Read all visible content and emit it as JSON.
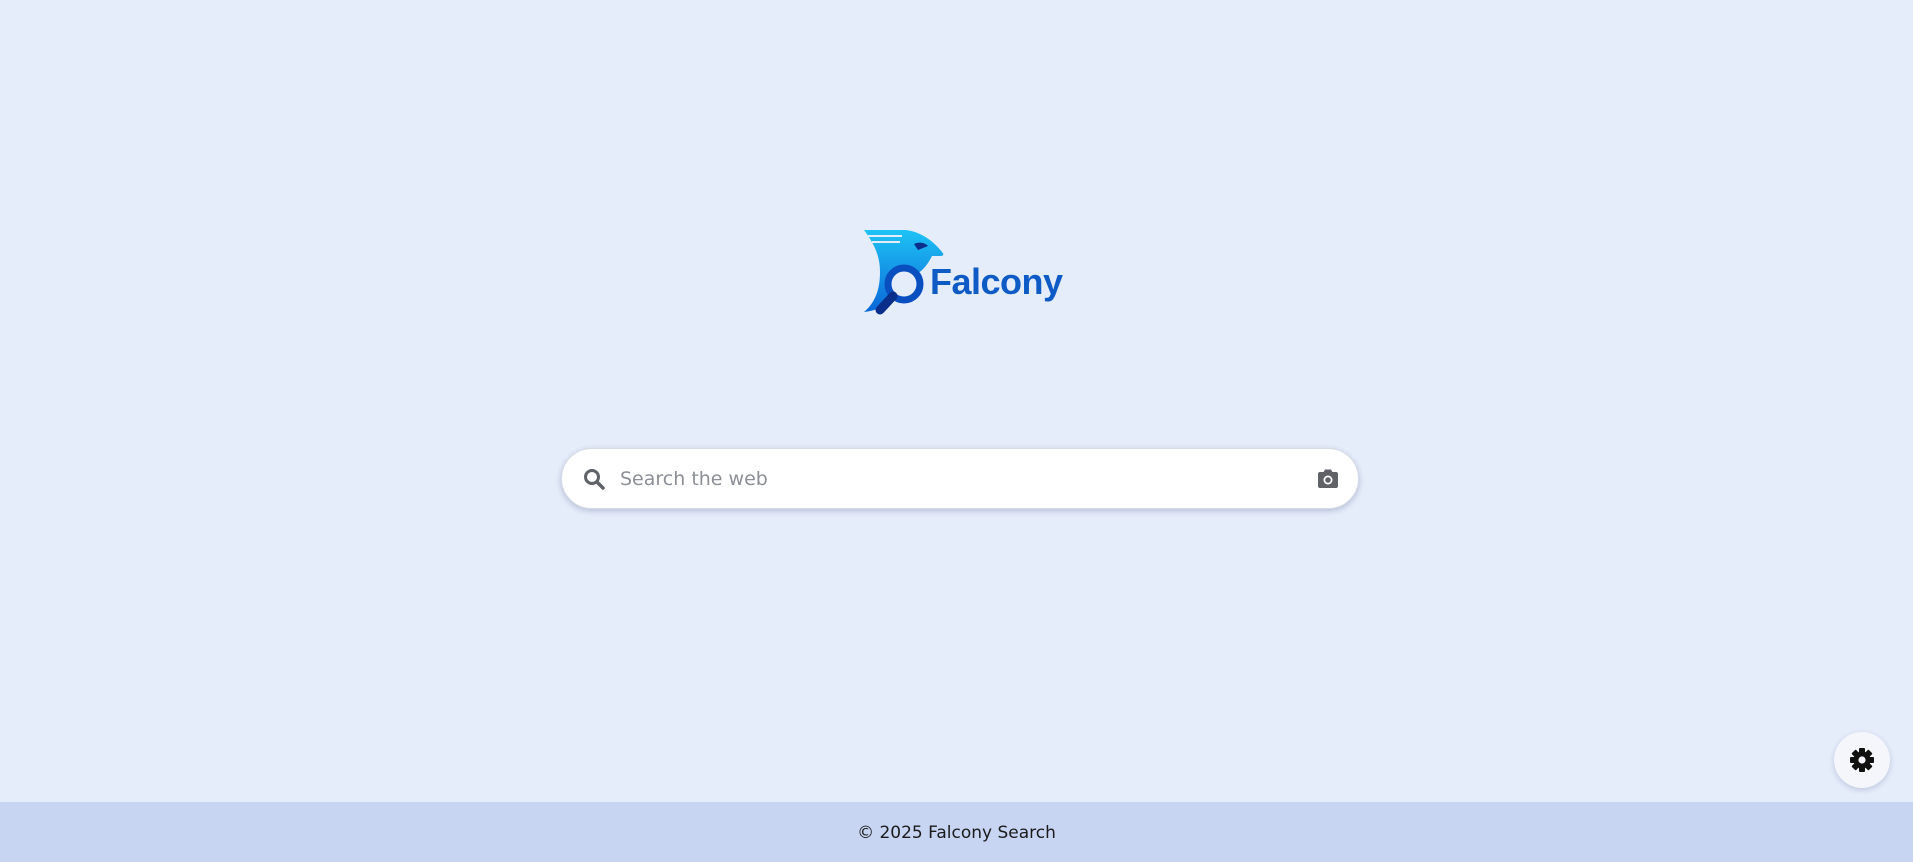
{
  "logo": {
    "text": "Falcony",
    "icon": "falcon-magnifier-logo",
    "colors": {
      "text": "#0f5bc6",
      "light": "#1ec3f5",
      "dark": "#0a4fc0"
    }
  },
  "search": {
    "placeholder": "Search the web",
    "value": "",
    "left_icon": "search-icon",
    "right_icon": "camera-icon"
  },
  "settings": {
    "icon": "gear-icon"
  },
  "footer": {
    "text": "© 2025 Falcony Search"
  },
  "colors": {
    "background": "#e5ecfa",
    "footer_background": "#c7d5f3",
    "icon_gray": "#5f6368"
  }
}
